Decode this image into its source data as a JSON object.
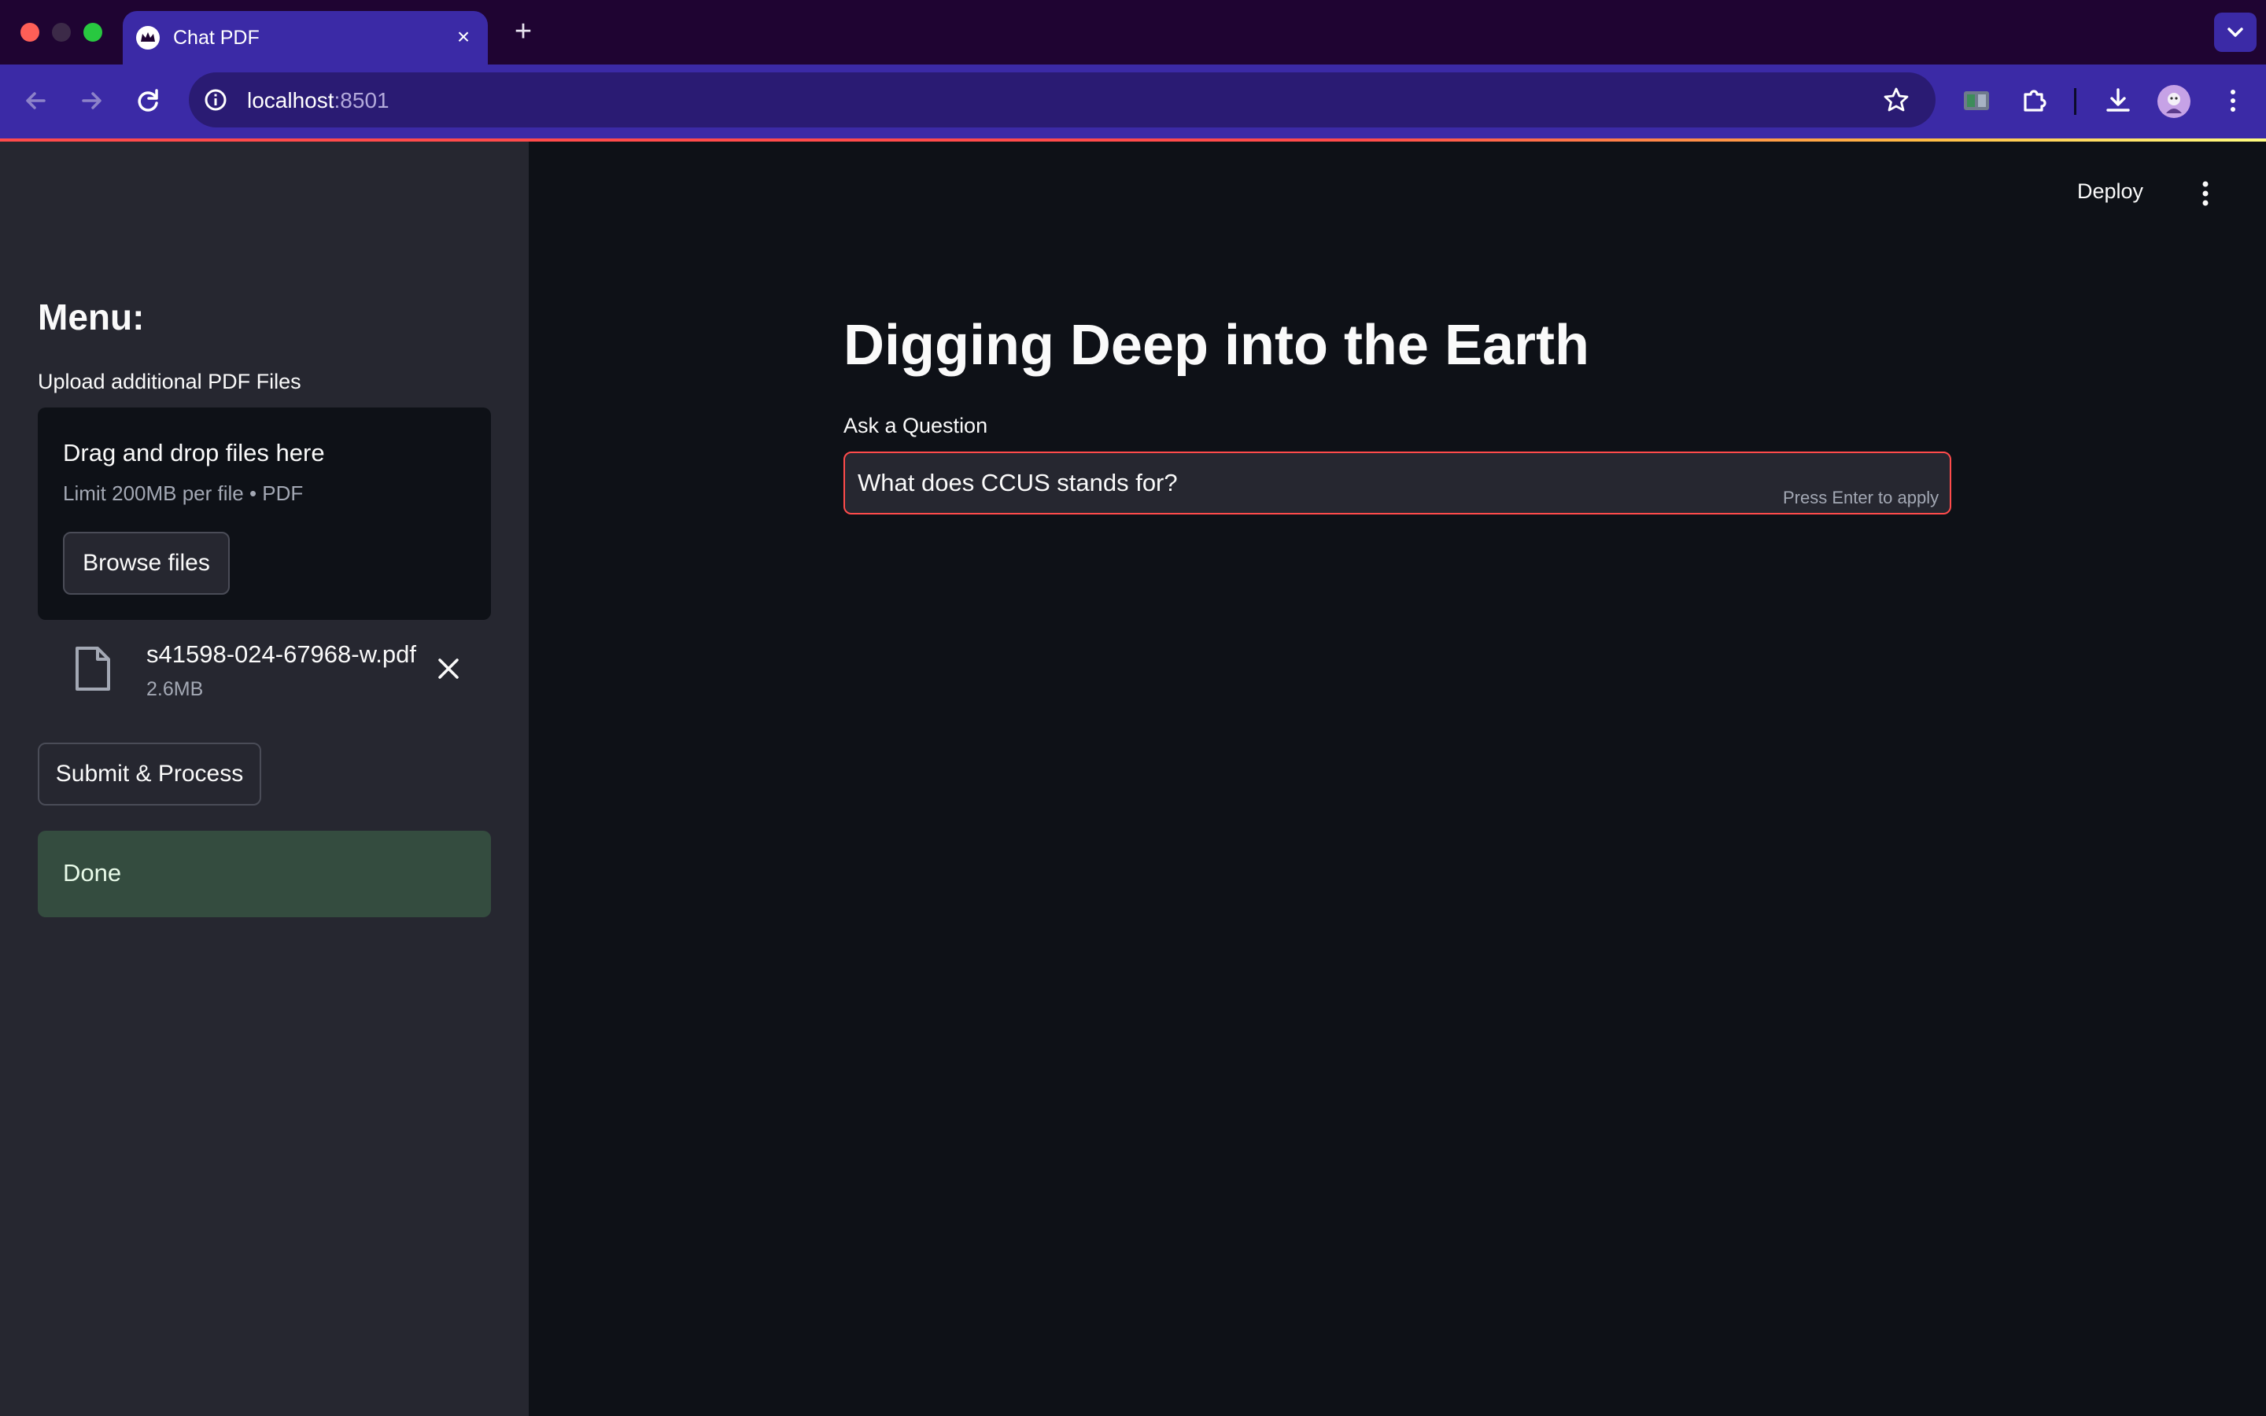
{
  "browser": {
    "tab_title": "Chat PDF",
    "url_host": "localhost",
    "url_port": ":8501",
    "new_tab_symbol": "+",
    "tab_close_symbol": "×"
  },
  "sidebar": {
    "menu_title": "Menu:",
    "upload_label": "Upload additional PDF Files",
    "dropzone_title": "Drag and drop files here",
    "dropzone_limit": "Limit 200MB per file • PDF",
    "browse_button": "Browse files",
    "file": {
      "name": "s41598-024-67968-w.pdf",
      "size": "2.6MB"
    },
    "submit_button": "Submit & Process",
    "status": "Done"
  },
  "main": {
    "deploy_label": "Deploy",
    "title": "Digging Deep into the Earth",
    "question_label": "Ask a Question",
    "question_value": "What does CCUS stands for?",
    "question_hint": "Press Enter to apply"
  },
  "colors": {
    "accent": "#ff4b4b",
    "tab_bar": "#1f0432",
    "toolbar": "#3b2aa6",
    "sidebar_bg": "#262730",
    "main_bg": "#0e1117",
    "success_bg": "#344c3f"
  },
  "icons": [
    "crown-icon",
    "back-icon",
    "forward-icon",
    "reload-icon",
    "info-icon",
    "star-icon",
    "extension-icon",
    "puzzle-icon",
    "download-icon",
    "profile-avatar",
    "chrome-menu-icon",
    "chevron-down-icon",
    "file-icon",
    "close-icon",
    "kebab-menu-icon"
  ]
}
